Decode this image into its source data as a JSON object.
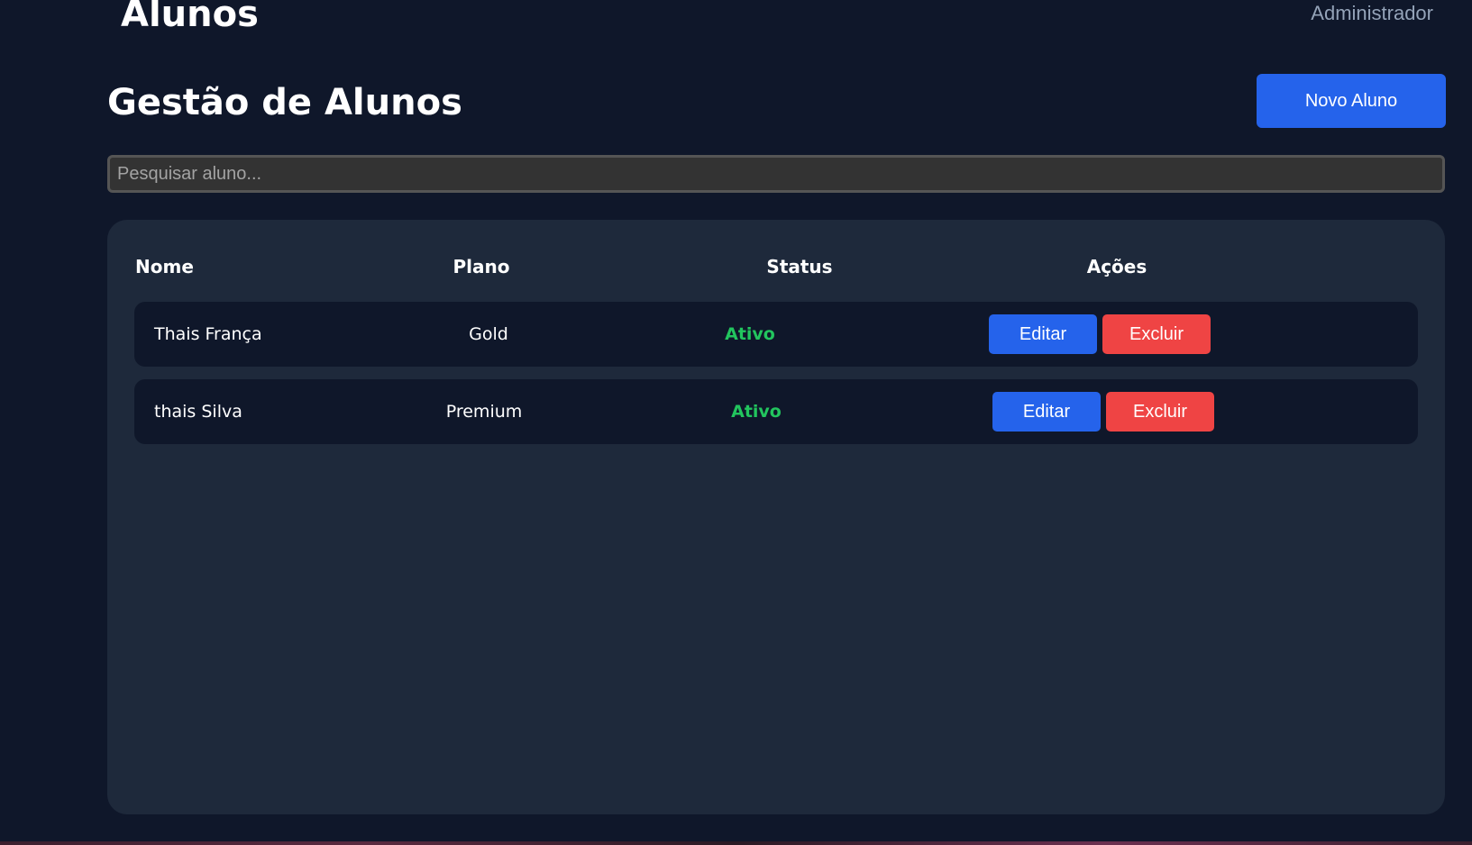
{
  "header": {
    "title": "Alunos",
    "user": "Administrador"
  },
  "page": {
    "heading": "Gestão de Alunos",
    "new_button_label": "Novo Aluno"
  },
  "search": {
    "placeholder": "Pesquisar aluno...",
    "value": ""
  },
  "table": {
    "columns": [
      "Nome",
      "Plano",
      "Status",
      "Ações"
    ],
    "rows": [
      {
        "name": "Thais França",
        "plan": "Gold",
        "status": "Ativo",
        "edit_label": "Editar",
        "delete_label": "Excluir"
      },
      {
        "name": "thais Silva",
        "plan": "Premium",
        "status": "Ativo",
        "edit_label": "Editar",
        "delete_label": "Excluir"
      }
    ]
  },
  "colors": {
    "background": "#0f172a",
    "card": "#1e293b",
    "primary": "#2563eb",
    "danger": "#ef4444",
    "success": "#22c55e"
  }
}
